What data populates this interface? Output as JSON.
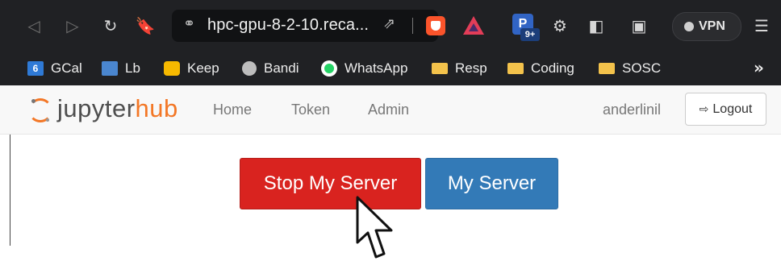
{
  "browser": {
    "url": "hpc-gpu-8-2-10.reca...",
    "extension_badge": "9+",
    "vpn_label": "VPN",
    "bookmarks": [
      {
        "label": "GCal",
        "icon": "google-calendar-icon",
        "icon_text": "6"
      },
      {
        "label": "Lb",
        "icon": "lb-icon"
      },
      {
        "label": "Keep",
        "icon": "google-keep-icon"
      },
      {
        "label": "Bandi",
        "icon": "globe-icon"
      },
      {
        "label": "WhatsApp",
        "icon": "whatsapp-icon"
      },
      {
        "label": "Resp",
        "icon": "folder-icon"
      },
      {
        "label": "Coding",
        "icon": "folder-icon"
      },
      {
        "label": "SOSC",
        "icon": "folder-icon"
      }
    ],
    "more_bookmarks": "»"
  },
  "jupyterhub": {
    "logo": {
      "part1": "jupyter",
      "part2": "hub"
    },
    "nav": [
      "Home",
      "Token",
      "Admin"
    ],
    "user": "anderlinil",
    "logout_label": "Logout",
    "stop_button": "Stop My Server",
    "my_server_button": "My Server"
  },
  "colors": {
    "stop": "#d9231f",
    "my_server": "#337ab7",
    "brand_orange": "#f37726"
  }
}
